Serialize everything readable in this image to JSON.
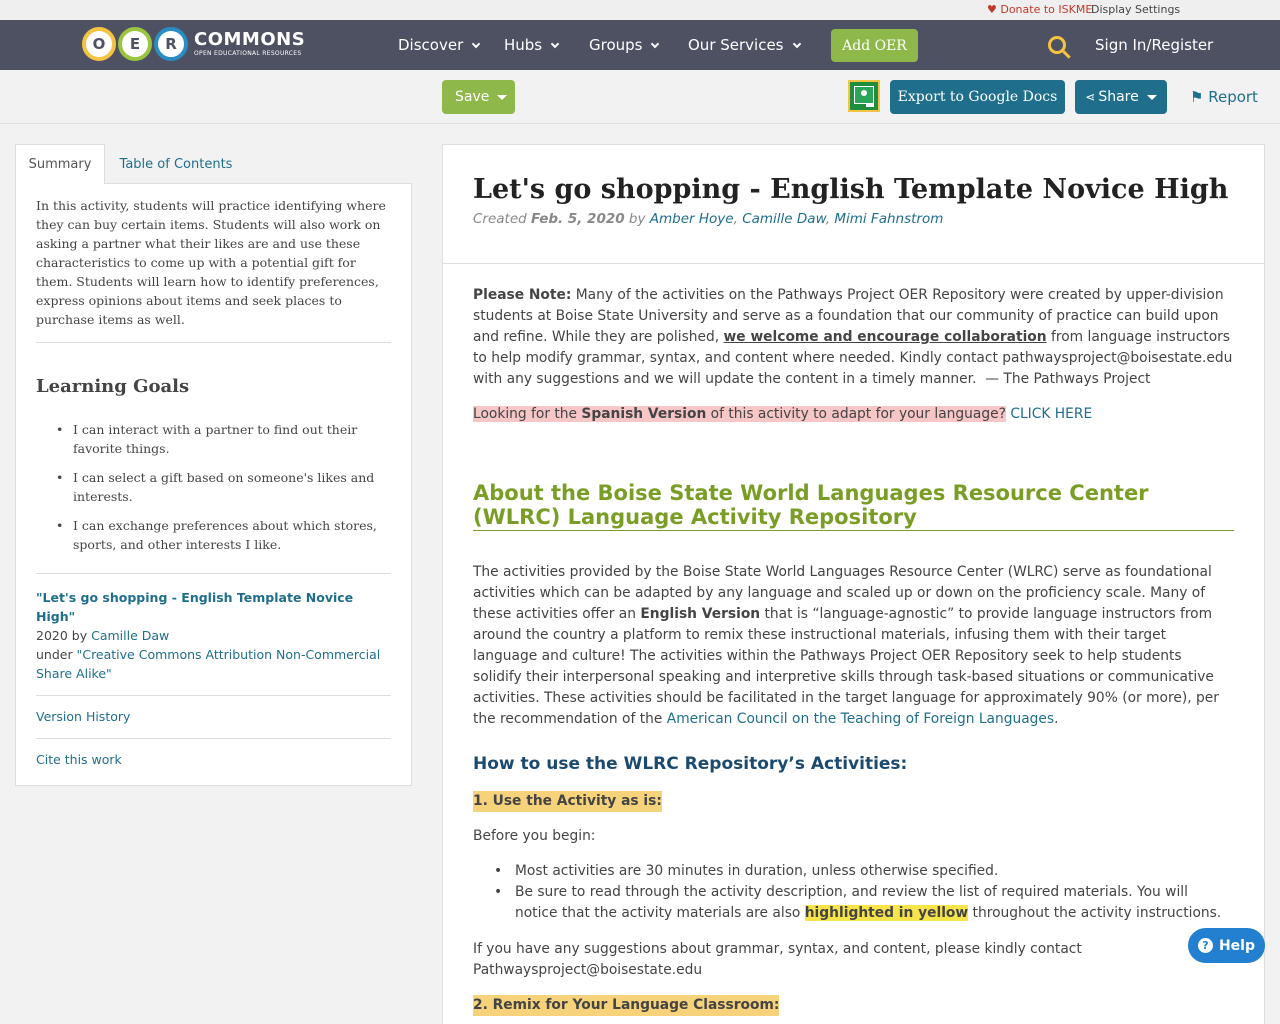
{
  "utilbar": {
    "donate": "♥ Donate to ISKME",
    "display_settings": "Display Settings"
  },
  "nav": {
    "logo_letters": [
      "O",
      "E",
      "R"
    ],
    "logo_word": "COMMONS",
    "logo_tagline": "OPEN EDUCATIONAL RESOURCES",
    "items": [
      "Discover",
      "Hubs",
      "Groups",
      "Our Services"
    ],
    "add_oer": "Add OER",
    "signin": "Sign In/Register"
  },
  "toolbar": {
    "save": "Save",
    "export": "Export to Google Docs",
    "share": "Share",
    "report": "⚑ Report"
  },
  "sidebar": {
    "tabs": [
      "Summary",
      "Table of Contents"
    ],
    "summary": "In this activity, students will practice identifying where they can buy certain items. Students will also work on asking a partner what their likes are and use these characteristics to come up with a potential gift for them. Students will learn how to identify preferences, express opinions about items and seek places to purchase items as well.",
    "learning_goals_title": "Learning Goals",
    "goals": [
      "I can interact with a partner to find out their favorite things.",
      "I can select a gift based on someone's likes and interests.",
      "I can exchange preferences about which stores, sports, and other interests I like."
    ],
    "attribution": {
      "title": "\"Let's go shopping - English Template Novice High\"",
      "year_by": "2020 by ",
      "author": "Camille Daw",
      "under": "under ",
      "license": "\"Creative Commons Attribution Non-Commercial Share Alike\""
    },
    "version_history": "Version History",
    "cite": "Cite this work"
  },
  "main": {
    "title": "Let's go shopping - English Template Novice High",
    "created_label": "Created ",
    "created_date": "Feb. 5, 2020",
    "by": " by ",
    "authors": [
      "Amber Hoye",
      "Camille Daw",
      "Mimi Fahnstrom"
    ],
    "note_label": "Please Note:",
    "note_1": " Many of the activities on the Pathways Project OER Repository were created by upper-division students at Boise State University and serve as a foundation that our community of practice can build upon and refine. While they are polished, ",
    "note_bold": "we welcome and encourage collaboration",
    "note_2": " from language instructors to help modify grammar, syntax, and content where needed. Kindly contact pathwaysproject@boisestate.edu with any suggestions and we will update the content in a timely manner.  — The Pathways Project",
    "spanish_1": "Looking for the ",
    "spanish_bold": "Spanish Version",
    "spanish_2": " of this activity to adapt for your language?",
    "click_here": "CLICK HERE",
    "about_heading": "About the Boise State World Languages Resource Center (WLRC) Language Activity Repository",
    "about_1": "The activities provided by the Boise State World Languages Resource Center (WLRC) serve as foundational activities which can be adapted by any language and scaled up or down on the proficiency scale. Many of these activities offer an ",
    "about_bold": "English Version",
    "about_2": " that is “language-agnostic” to provide language instructors from around the country a platform to remix these instructional materials, infusing them with their target language and culture! The activities within the Pathways Project OER Repository seek to help students solidify their interpersonal speaking and interpretive skills through task-based situations or communicative activities. These activities should be facilitated in the target language for approximately 90% (or more), per the recommendation of the ",
    "about_link": "American Council on the Teaching of Foreign Languages",
    "about_end": ".",
    "howto_heading": "How to use the WLRC Repository’s Activities:",
    "step1": "1. Use the Activity as is:",
    "before": "Before you begin:",
    "bullet1": "Most activities are 30 minutes in duration, unless otherwise specified.",
    "bullet2_1": "Be sure to read through the activity description, and review the list of required materials. You will notice that the activity materials are also ",
    "bullet2_hl": "highlighted in yellow",
    "bullet2_2": " throughout the activity instructions.",
    "suggest": "If you have any suggestions about grammar, syntax, and content, please kindly contact Pathwaysproject@boisestate.edu",
    "step2": "2. Remix for Your Language Classroom:"
  },
  "help": {
    "label": "Help",
    "glyph": "?"
  },
  "colors": {
    "nav_bg": "#4d5162",
    "green": "#8fb84a",
    "teal": "#1f6e8c",
    "heading_green": "#7a9e25",
    "help_blue": "#2380d0"
  }
}
